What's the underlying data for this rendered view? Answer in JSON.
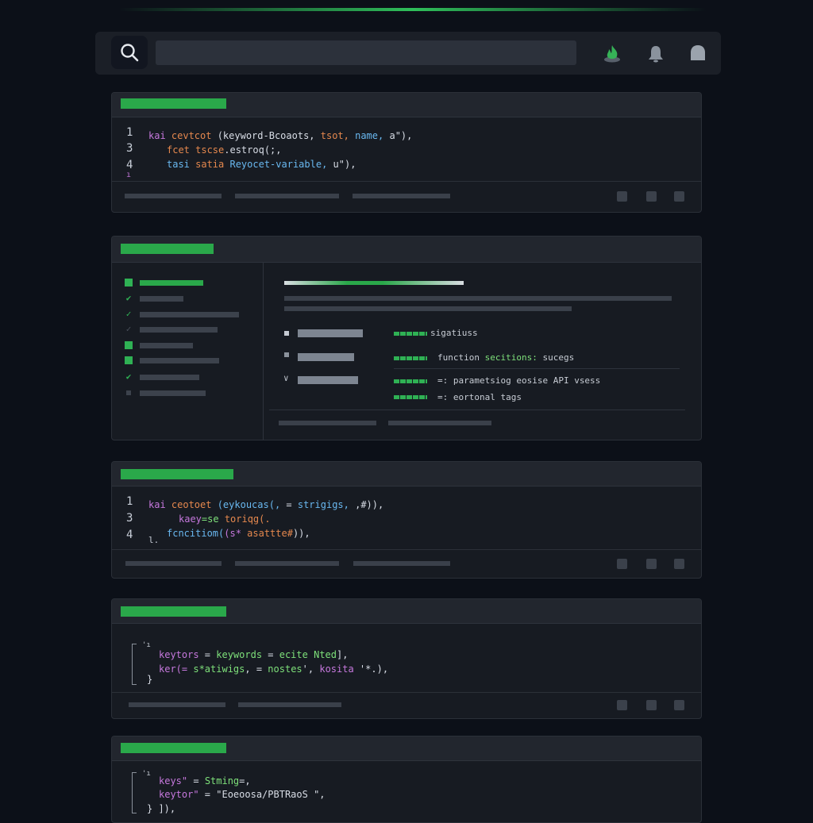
{
  "search": {
    "placeholder": "",
    "value": ""
  },
  "colors": {
    "accent": "#2aa84a",
    "bg": "#0c1018",
    "panel": "#171b22",
    "keyword": "#c678dd",
    "function": "#e5884e",
    "identifier": "#69b8f0",
    "string": "#7ee07a"
  },
  "toolbar": {
    "icons": [
      "search-icon",
      "flame-icon",
      "bell-icon",
      "user-icon"
    ]
  },
  "panel1": {
    "line_numbers": [
      "1",
      "3",
      "4",
      "ı"
    ],
    "lines": [
      {
        "a": "kai ",
        "b": "cevtcot ",
        "c": "(keyword-Bcoaots, ",
        "d": "tsot, ",
        "e": "name, ",
        "f": "a\"),"
      },
      {
        "a": "fcet ",
        "b": "tscse",
        "c": ".estroq(;,"
      },
      {
        "a": "tasi ",
        "b": "satia ",
        "c": "Reyocet-variable, ",
        "d": "u\"),"
      }
    ]
  },
  "panel2": {
    "rows": [
      {
        "label": "sigatiuss"
      },
      {
        "label": "function ",
        "highlight": "secitions:",
        "rest": " sucegs"
      },
      {
        "label": "=: parametsiog ",
        "rest": "eosise API vsess"
      },
      {
        "label": "=: eortonal tags"
      }
    ]
  },
  "panel3": {
    "line_numbers": [
      "1",
      "3",
      "4",
      "l."
    ],
    "lines": [
      {
        "a": "kai ",
        "b": "ceotoet ",
        "c": "(eykoucas(, ",
        "d": "= ",
        "e": "strigigs, ",
        "f": ",#)),"
      },
      {
        "a": "kaey",
        "b": "=se ",
        "c": "toriqg(."
      },
      {
        "a": "fcncitiom(",
        "b": "(s* ",
        "c": "asattte#",
        "d": ")),"
      }
    ]
  },
  "panel4": {
    "lines": [
      {
        "a": "keytors ",
        "b": "= ",
        "c": "keywords ",
        "d": "= ",
        "e": "ecite ",
        "f": "Nted",
        "g": "],"
      },
      {
        "a": "ker(= ",
        "b": "s*atiwigs",
        "c": ", = ",
        "d": "nostes",
        "e": "', ",
        "f": "kosita ",
        "g": "'*.),"
      },
      {
        "a": "}"
      }
    ]
  },
  "panel5": {
    "lines": [
      {
        "a": "keys\" ",
        "b": "= ",
        "c": "Stming",
        "d": "=,"
      },
      {
        "a": "keytor\" ",
        "b": "= ",
        "c": "\"Eoeoosa/PBTRaoS ",
        "d": "\","
      },
      {
        "a": "} ",
        "b": "]),"
      }
    ]
  }
}
